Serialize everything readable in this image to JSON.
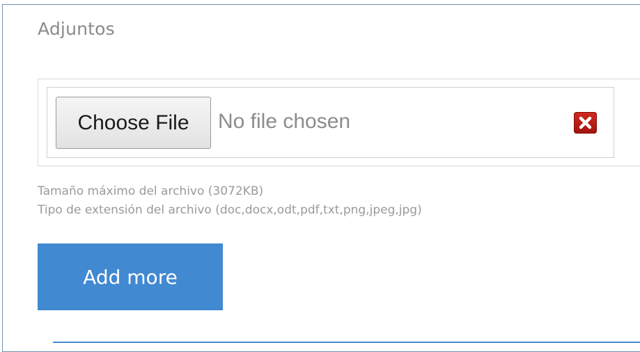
{
  "section": {
    "title": "Adjuntos"
  },
  "file_input": {
    "button_label": "Choose File",
    "status_text": "No file chosen",
    "remove_icon": "close-icon"
  },
  "hints": {
    "max_size": "Tamaño máximo del archivo (3072KB)",
    "extensions": "Tipo de extensión del archivo (doc,docx,odt,pdf,txt,png,jpeg,jpg)"
  },
  "actions": {
    "add_more_label": "Add more"
  },
  "colors": {
    "accent": "#4189d1",
    "remove": "#b81c14",
    "frame": "#6e8fb0"
  }
}
